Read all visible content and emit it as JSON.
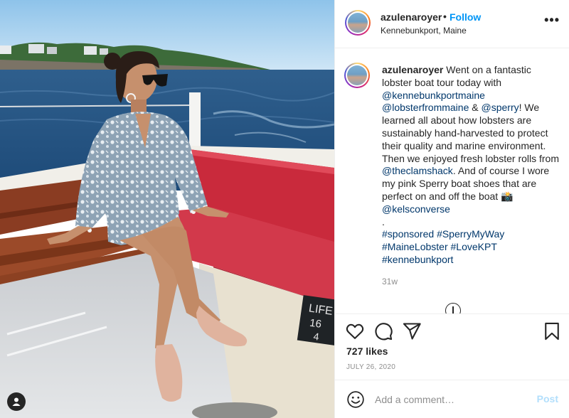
{
  "post": {
    "username": "azulenaroyer",
    "follow_label": "Follow",
    "dot": "•",
    "location": "Kennebunkport, Maine",
    "more_label": "•••"
  },
  "caption": {
    "username": "azulenaroyer",
    "text1": " Went on a fantastic lobster boat tour today with ",
    "mention1": "@kennebunkportmaine",
    "mention2": "@lobsterfrommaine",
    "text2": " & ",
    "mention3": "@sperry",
    "text3": "! We learned all about how lobsters are sustainably hand-harvested to protect their quality and marine environment. Then we enjoyed fresh lobster rolls from ",
    "mention4": "@theclamshack",
    "text4": ". And of course I wore my pink Sperry boat shoes that are perfect on and off the boat 📸",
    "mention5": "@kelsconverse",
    "period": ".",
    "hashtag1": "#sponsored",
    "hashtag2": "#SperryMyWay",
    "hashtag3": "#MaineLobster",
    "hashtag4": "#LoveKPT",
    "hashtag5": "#kennebunkport",
    "time_ago": "31w"
  },
  "photo": {
    "sign_text_1": "LIFE",
    "sign_text_2": "16",
    "sign_text_3": "4"
  },
  "actions": {
    "like_icon": "heart-icon",
    "comment_icon": "comment-icon",
    "share_icon": "share-icon",
    "save_icon": "bookmark-icon"
  },
  "likes": "727 likes",
  "date": "JULY 26, 2020",
  "add_comment": {
    "placeholder": "Add a comment…",
    "post_label": "Post",
    "emoji_icon": "emoji-icon"
  },
  "colors": {
    "link": "#00376b",
    "follow": "#0095f6",
    "post_disabled": "#b2dffc"
  }
}
